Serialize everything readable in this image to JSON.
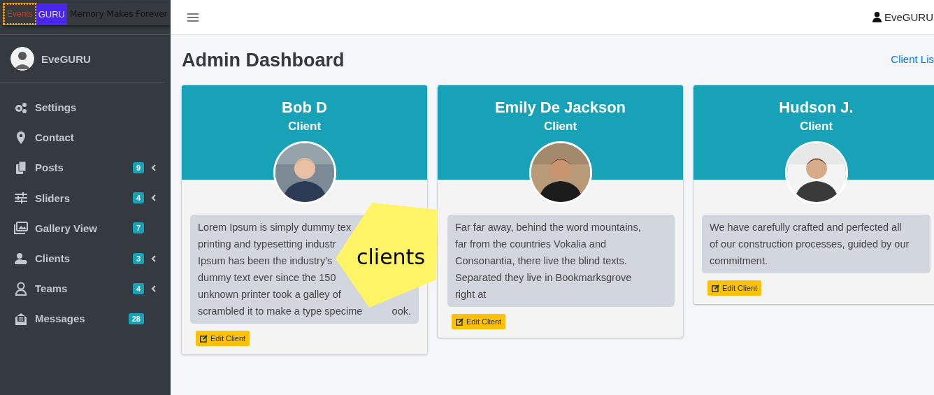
{
  "brand": {
    "part_1": "Events",
    "part_2": "GURU",
    "tagline": "Memory Makes Forever"
  },
  "sidebar": {
    "user": "EveGURU",
    "items": [
      {
        "label": "Settings",
        "expandable": false
      },
      {
        "label": "Contact",
        "expandable": false
      },
      {
        "label": "Posts",
        "badge": "9",
        "expandable": true
      },
      {
        "label": "Sliders",
        "badge": "4",
        "expandable": true
      },
      {
        "label": "Gallery View",
        "badge": "7",
        "expandable": false
      },
      {
        "label": "Clients",
        "badge": "3",
        "expandable": true
      },
      {
        "label": "Teams",
        "badge": "4",
        "expandable": true
      },
      {
        "label": "Messages",
        "badge": "28",
        "expandable": false
      }
    ]
  },
  "topbar": {
    "user": "EveGURU"
  },
  "page": {
    "title": "Admin Dashboard",
    "link": "Client Lis"
  },
  "clients": [
    {
      "name": "Bob D",
      "role": "Client",
      "lines": [
        {
          "text": "Lorem Ipsum is simply dummy tex"
        },
        {
          "text": "printing and typesetting industr"
        },
        {
          "text": "Ipsum has been the industry's"
        },
        {
          "text": "dummy text ever since the 150"
        },
        {
          "text": "unknown printer took a galley of"
        },
        {
          "text": "scrambled it to make a type specime",
          "tail": "ook."
        }
      ],
      "button": "Edit Client"
    },
    {
      "name": "Emily De Jackson",
      "role": "Client",
      "lines": [
        {
          "text": "Far far away, behind the word mountains,"
        },
        {
          "text": "far from the countries Vokalia and"
        },
        {
          "text": "Consonantia, there live the blind texts."
        },
        {
          "text": "Separated they live in Bookmarksgrove"
        },
        {
          "text": "right at"
        }
      ],
      "button": "Edit Client"
    },
    {
      "name": "Hudson J.",
      "role": "Client",
      "lines": [
        {
          "text": "We have carefully crafted and perfected all"
        },
        {
          "text": "of our construction processes, guided by our"
        },
        {
          "text": "commitment."
        }
      ],
      "button": "Edit Client"
    }
  ],
  "sticker": {
    "label": "clients"
  }
}
